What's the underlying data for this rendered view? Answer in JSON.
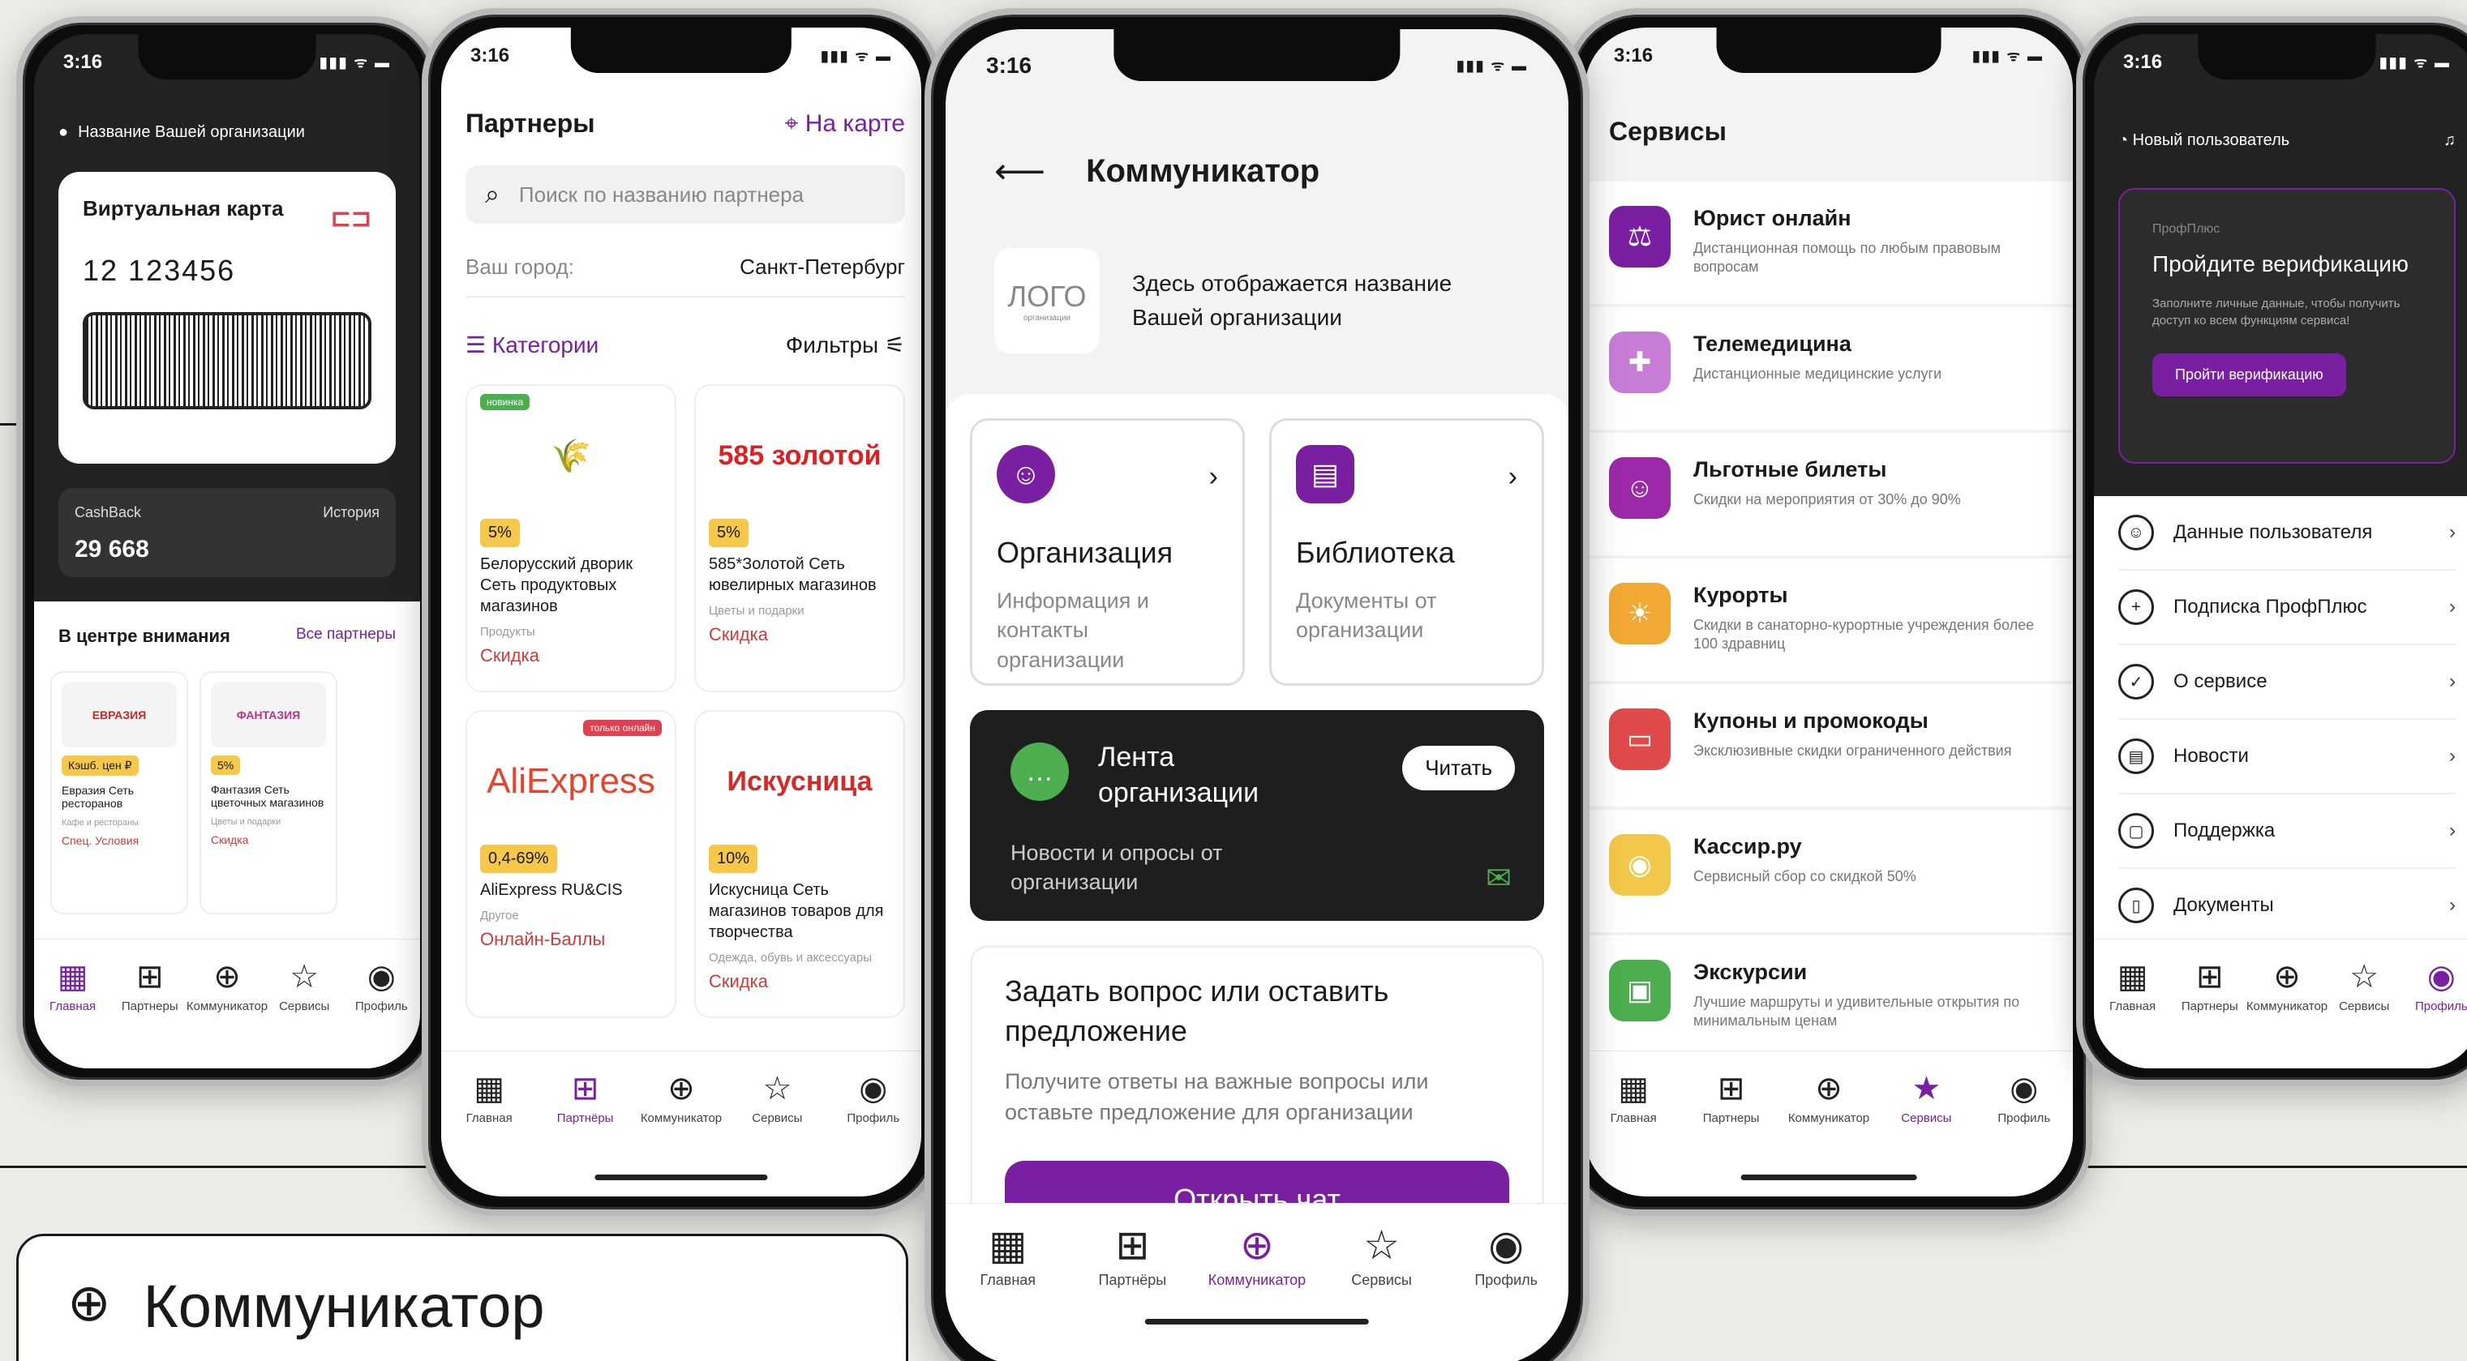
{
  "status_time": "3:16",
  "signal": "▮▮▮ ᯤ ▬",
  "tabs": [
    "Главная",
    "Партнёры",
    "Коммуникатор",
    "Сервисы",
    "Профиль"
  ],
  "tabs_alt": [
    "Главная",
    "Партнеры",
    "Коммуникатор",
    "Сервисы",
    "Профиль"
  ],
  "phone1": {
    "org_name": "Название Вашей организации",
    "card_title": "Виртуальная карта",
    "card_number": "12 123456",
    "card_logo": "⊏⊐",
    "cashback_label": "CashBack",
    "cashback_value": "29 668",
    "history": "История",
    "focus_title": "В центре внимания",
    "all_partners": "Все партнеры",
    "cards": [
      {
        "img": "ЕВРАЗИЯ",
        "badge": "Кэшб. цен ₽",
        "name": "Евразия Сеть ресторанов",
        "cat": "Кафе и рестораны",
        "red": "Спец. Условия"
      },
      {
        "img": "ФАНТАЗИЯ",
        "badge": "5%",
        "name": "Фантазия Сеть цветочных магазинов",
        "cat": "Цветы и подарки",
        "red": "Скидка"
      }
    ]
  },
  "phone2": {
    "title": "Партнеры",
    "map": "На карте",
    "search_placeholder": "Поиск по названию партнера",
    "city_label": "Ваш город:",
    "city_value": "Санкт-Петербург",
    "categories": "Категории",
    "filters": "Фильтры",
    "cards": [
      {
        "img": "🌾",
        "tag": "новинка",
        "badge": "5%",
        "name": "Белорусский дворик Сеть продуктовых магазинов",
        "cat": "Продукты",
        "red": "Скидка"
      },
      {
        "img": "585 золотой",
        "tag": "",
        "badge": "5%",
        "name": "585*Золотой Сеть ювелирных магазинов",
        "cat": "Цветы и подарки",
        "red": "Скидка"
      },
      {
        "img": "AliExpress",
        "tag": "только онлайн",
        "badge": "0,4-69%",
        "name": "AliExpress RU&CIS",
        "cat": "Другое",
        "red": "Онлайн-Баллы"
      },
      {
        "img": "Искусница",
        "tag": "",
        "badge": "10%",
        "name": "Искусница Сеть магазинов товаров для творчества",
        "cat": "Одежда, обувь и аксессуары",
        "red": "Скидка"
      }
    ]
  },
  "phone3": {
    "title": "Коммуникатор",
    "logo": "ЛОГО",
    "logo_sub": "организации",
    "org_text": "Здесь отображается название Вашей организации",
    "tile1_title": "Организация",
    "tile1_sub": "Информация и контакты организации",
    "tile2_title": "Библиотека",
    "tile2_sub": "Документы от организации",
    "feed_title": "Лента организации",
    "feed_read": "Читать",
    "feed_sub": "Новости и опросы от организации",
    "ask_title": "Задать вопрос или оставить предложение",
    "ask_sub": "Получите ответы на важные вопросы или оставьте предложение для организации",
    "ask_button": "Открыть чат"
  },
  "phone4": {
    "title": "Сервисы",
    "services": [
      {
        "title": "Юрист онлайн",
        "sub": "Дистанционная помощь по любым правовым вопросам",
        "color": "#7b1fa2",
        "icon": "⚖"
      },
      {
        "title": "Телемедицина",
        "sub": "Дистанционные медицинские услуги",
        "color": "#c77dd6",
        "icon": "✚"
      },
      {
        "title": "Льготные билеты",
        "sub": "Скидки на мероприятия от 30% до 90%",
        "color": "#9c2aa8",
        "icon": "☺"
      },
      {
        "title": "Курорты",
        "sub": "Скидки в санаторно-курортные учреждения более 100 здравниц",
        "color": "#f2a933",
        "icon": "☀"
      },
      {
        "title": "Купоны и промокоды",
        "sub": "Эксклюзивные скидки ограниченного действия",
        "color": "#e04a4a",
        "icon": "▭"
      },
      {
        "title": "Кассир.ру",
        "sub": "Сервисный сбор со скидкой 50%",
        "color": "#f2c84a",
        "icon": "◉"
      },
      {
        "title": "Экскурсии",
        "sub": "Лучшие маршруты и удивительные открытия по минимальным ценам",
        "color": "#4cae4f",
        "icon": "▣"
      }
    ]
  },
  "phone5": {
    "user": "Новый пользователь",
    "small": "ПрофПлюс",
    "verif_title": "Пройдите верификацию",
    "verif_sub": "Заполните личные данные, чтобы получить доступ ко всем функциям сервиса!",
    "verif_button": "Пройти верификацию",
    "menu": [
      "Данные пользователя",
      "Подписка ПрофПлюс",
      "О сервисе",
      "Новости",
      "Поддержка",
      "Документы"
    ]
  },
  "caption": "Коммуникатор",
  "accent": "#7b1fa2"
}
